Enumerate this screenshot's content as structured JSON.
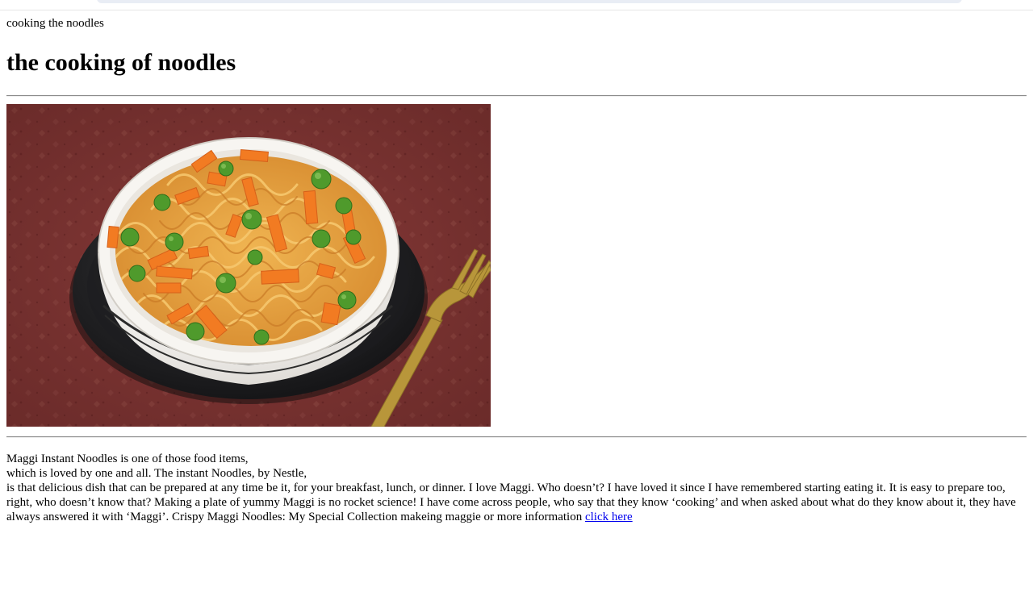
{
  "page": {
    "caption": "cooking the noodles",
    "heading": "the cooking of noodles",
    "paragraph_line1": "Maggi Instant Noodles is one of those food items,",
    "paragraph_line2": "which is loved by one and all. The instant Noodles, by Nestle,",
    "paragraph_rest": "is that delicious dish that can be prepared at any time be it, for your breakfast, lunch, or dinner. I love Maggi. Who doesn’t? I have loved it since I have remembered starting eating it. It is easy to prepare too, right, who doesn’t know that? Making a plate of yummy Maggi is no rocket science! I have come across people, who say that they know ‘cooking’ and when asked about what do they know about it, they have always answered it with ‘Maggi’. Crispy Maggi Noodles: My Special Collection makeing maggie or more information",
    "link_label": "click here"
  },
  "colors": {
    "link": "#0000ee",
    "tablecloth": "#8e3d3b",
    "plate": "#1c1c1e",
    "bowl": "#f4f2ee",
    "noodle": "#e8a441",
    "carrot": "#f07a22",
    "pea": "#4c9a2a",
    "fork": "#b9973a"
  }
}
